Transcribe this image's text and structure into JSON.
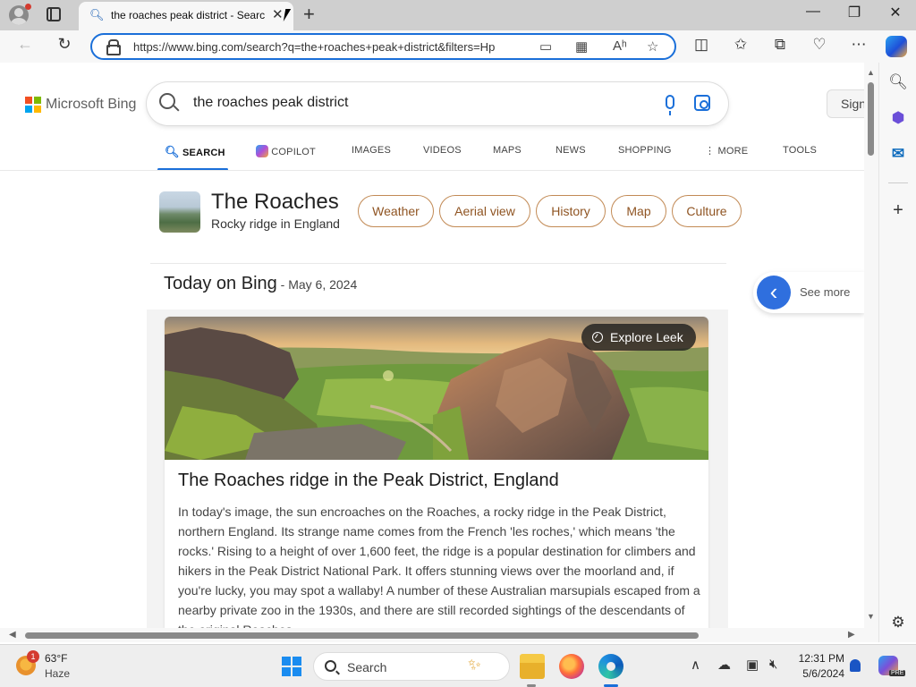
{
  "browser": {
    "tab_title": "the roaches peak district - Search",
    "url": "https://www.bing.com/search?q=the+roaches+peak+district&filters=Hp",
    "new_tab_glyph": "+",
    "close_glyph": "✕"
  },
  "bing": {
    "logo_text": "Microsoft Bing",
    "query": "the roaches peak district",
    "sign_in": "Sign in",
    "brand_colors": [
      "#f25022",
      "#7fba00",
      "#00a4ef",
      "#ffb900"
    ]
  },
  "scopes": [
    {
      "label": "SEARCH",
      "active": true
    },
    {
      "label": "COPILOT",
      "active": false
    },
    {
      "label": "IMAGES",
      "active": false
    },
    {
      "label": "VIDEOS",
      "active": false
    },
    {
      "label": "MAPS",
      "active": false
    },
    {
      "label": "NEWS",
      "active": false
    },
    {
      "label": "SHOPPING",
      "active": false
    },
    {
      "label": "MORE",
      "active": false
    },
    {
      "label": "TOOLS",
      "active": false
    }
  ],
  "entity": {
    "title": "The Roaches",
    "subtitle": "Rocky ridge in England",
    "pills": [
      "Weather",
      "Aerial view",
      "History",
      "Map",
      "Culture"
    ]
  },
  "today": {
    "title": "Today on Bing",
    "date": " - May 6, 2024",
    "see_more": "See more",
    "explore": "Explore Leek",
    "card_title": "The Roaches ridge in the Peak District, England",
    "card_body": "In today's image, the sun encroaches on the Roaches, a rocky ridge in the Peak District, northern England. Its strange name comes from the French 'les roches,' which means 'the rocks.' Rising to a height of over 1,600 feet, the ridge is a popular destination for climbers and hikers in the Peak District National Park. It offers stunning views over the moorland and, if you're lucky, you may spot a wallaby! A number of these Australian marsupials escaped from a nearby private zoo in the 1930s, and there are still recorded sightings of the descendants of the original Roaches..."
  },
  "taskbar": {
    "weather_temp": "63°F",
    "weather_cond": "Haze",
    "weather_badge": "1",
    "search_label": "Search",
    "time": "12:31 PM",
    "date": "5/6/2024",
    "pre": "PRE"
  },
  "colors": {
    "accent": "#1a6fd9",
    "pill_border": "#c28a55",
    "pill_text": "#8f5422"
  }
}
